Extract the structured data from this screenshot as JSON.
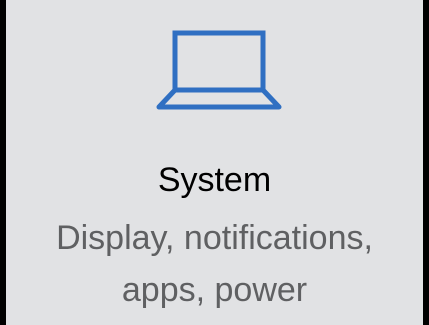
{
  "tile": {
    "title": "System",
    "description_line1": "Display, notifications,",
    "description_line2": "apps, power",
    "icon": "laptop-icon"
  },
  "colors": {
    "tile_background": "#e1e2e4",
    "border": "#000000",
    "icon_accent": "#2f6fc2",
    "title_text": "#000000",
    "description_text": "#5f6062"
  }
}
